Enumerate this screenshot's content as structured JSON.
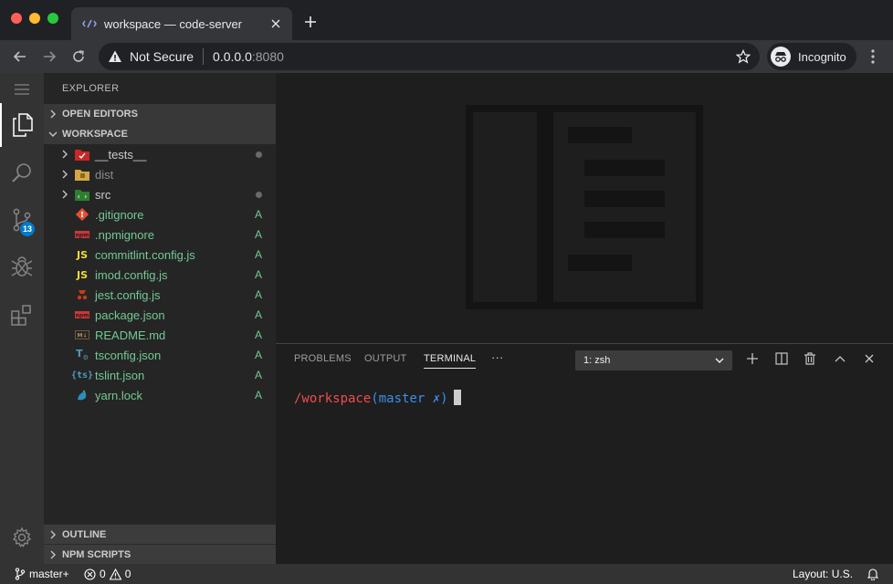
{
  "browser": {
    "tab_title": "workspace — code-server",
    "security_label": "Not Secure",
    "url_host": "0.0.0.0",
    "url_port": ":8080",
    "profile_label": "Incognito"
  },
  "sidebar": {
    "title": "EXPLORER",
    "open_editors": "OPEN EDITORS",
    "workspace": "WORKSPACE",
    "outline": "OUTLINE",
    "npm_scripts": "NPM SCRIPTS",
    "files": [
      {
        "name": "__tests__",
        "type": "folder",
        "icon": "tests-folder-icon",
        "status": "dot",
        "color": "#cccccc"
      },
      {
        "name": "dist",
        "type": "folder",
        "icon": "dist-folder-icon",
        "status": "",
        "color": "#8c8c8c"
      },
      {
        "name": "src",
        "type": "folder",
        "icon": "src-folder-icon",
        "status": "dot",
        "color": "#cccccc"
      },
      {
        "name": ".gitignore",
        "type": "file",
        "icon": "git-icon",
        "status": "A",
        "color": "#73c991"
      },
      {
        "name": ".npmignore",
        "type": "file",
        "icon": "npm-icon",
        "status": "A",
        "color": "#73c991"
      },
      {
        "name": "commitlint.config.js",
        "type": "file",
        "icon": "js-icon",
        "status": "A",
        "color": "#73c991"
      },
      {
        "name": "imod.config.js",
        "type": "file",
        "icon": "js-icon",
        "status": "A",
        "color": "#73c991"
      },
      {
        "name": "jest.config.js",
        "type": "file",
        "icon": "jest-icon",
        "status": "A",
        "color": "#73c991"
      },
      {
        "name": "package.json",
        "type": "file",
        "icon": "npm-icon",
        "status": "A",
        "color": "#73c991"
      },
      {
        "name": "README.md",
        "type": "file",
        "icon": "markdown-icon",
        "status": "A",
        "color": "#73c991"
      },
      {
        "name": "tsconfig.json",
        "type": "file",
        "icon": "tsconfig-icon",
        "status": "A",
        "color": "#73c991"
      },
      {
        "name": "tslint.json",
        "type": "file",
        "icon": "tslint-icon",
        "status": "A",
        "color": "#73c991"
      },
      {
        "name": "yarn.lock",
        "type": "file",
        "icon": "yarn-icon",
        "status": "A",
        "color": "#73c991"
      }
    ]
  },
  "activity": {
    "scm_badge": "13"
  },
  "panel": {
    "tabs": [
      "PROBLEMS",
      "OUTPUT",
      "TERMINAL"
    ],
    "more": "···",
    "terminal_select": "1: zsh",
    "prompt_path": "/workspace",
    "prompt_branch_open": "(",
    "prompt_branch": "master ✗",
    "prompt_branch_close": ")"
  },
  "status": {
    "branch": "master+",
    "errors": "0",
    "warnings": "0",
    "layout": "Layout: U.S."
  },
  "colors": {
    "accent": "#007acc",
    "added_green": "#73c991",
    "prompt_red": "#f14c4c",
    "prompt_blue": "#3b8eea"
  }
}
